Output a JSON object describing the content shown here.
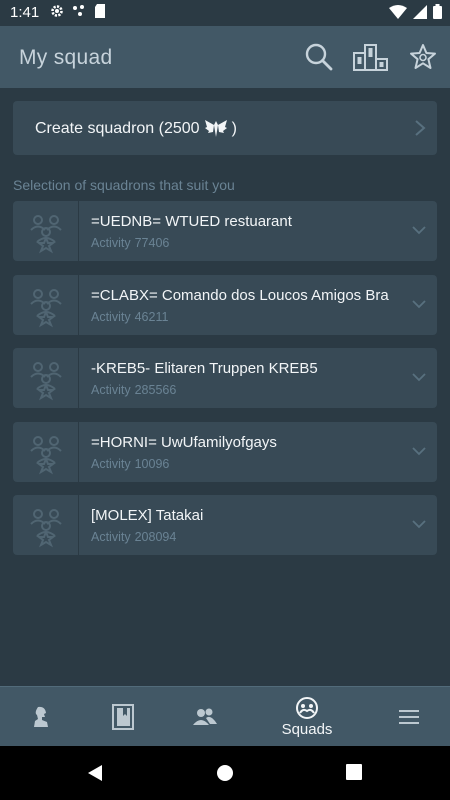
{
  "status_bar": {
    "time": "1:41"
  },
  "app_bar": {
    "title": "My squad"
  },
  "create_squadron": {
    "label": "Create squadron (2500"
  },
  "section": {
    "title": "Selection of squadrons that suit you"
  },
  "squadrons": [
    {
      "name": "=UEDNB= WTUED restuarant",
      "activity_label": "Activity",
      "activity_value": "77406"
    },
    {
      "name": "=CLABX= Comando dos Loucos Amigos Bra",
      "activity_label": "Activity",
      "activity_value": "46211"
    },
    {
      "name": "-KREB5- Elitaren Truppen KREB5",
      "activity_label": "Activity",
      "activity_value": "285566"
    },
    {
      "name": "=HORNI= UwUfamilyofgays",
      "activity_label": "Activity",
      "activity_value": "10096"
    },
    {
      "name": "[MOLEX] Tatakai",
      "activity_label": "Activity",
      "activity_value": "208094"
    }
  ],
  "bottom_nav": {
    "active_label": "Squads"
  },
  "colors": {
    "background": "#2b3a44",
    "bar": "#425866",
    "card": "#384a56",
    "muted_text": "#6a8394"
  }
}
